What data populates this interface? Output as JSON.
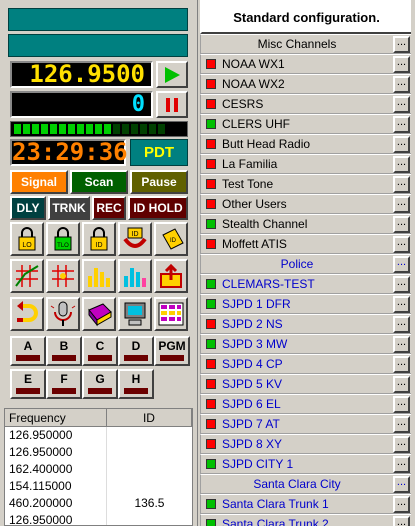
{
  "display": {
    "frequency": "126.9500",
    "counter": "0",
    "clock": "23:29:36",
    "timezone": "PDT"
  },
  "vu_level": {
    "lit": 11,
    "total": 17
  },
  "mode_buttons": [
    {
      "label": "Signal",
      "color": "#ff8000",
      "text": "#ffffff"
    },
    {
      "label": "Scan",
      "color": "#006000",
      "text": "#ffffff"
    },
    {
      "label": "Pause",
      "color": "#606000",
      "text": "#ffffff"
    }
  ],
  "flag_buttons": [
    {
      "label": "DLY"
    },
    {
      "label": "TRNK"
    },
    {
      "label": "REC"
    },
    {
      "label": "ID HOLD"
    }
  ],
  "icons_row1": [
    "lock-lo-icon",
    "lock-tlo-icon",
    "lock-id-icon",
    "hand-id-icon",
    "tag-id-icon"
  ],
  "icons_row2": [
    "grid-red-icon",
    "grid-red2-icon",
    "bars-yellow-icon",
    "bars-cyan-icon",
    "export-icon"
  ],
  "icons_row3": [
    "undo-icon",
    "microphone-icon",
    "book-icon",
    "computer-icon",
    "table-icon"
  ],
  "memory_buttons": [
    "A",
    "B",
    "C",
    "D",
    "PGM",
    "E",
    "F",
    "G",
    "H"
  ],
  "freq_table": {
    "headers": [
      "Frequency",
      "ID"
    ],
    "rows": [
      {
        "freq": "126.950000",
        "id": ""
      },
      {
        "freq": "126.950000",
        "id": ""
      },
      {
        "freq": "162.400000",
        "id": ""
      },
      {
        "freq": "154.115000",
        "id": ""
      },
      {
        "freq": "460.200000",
        "id": "136.5"
      },
      {
        "freq": "126.950000",
        "id": ""
      }
    ]
  },
  "config": {
    "title": "Standard configuration.",
    "dots": "...",
    "groups": [
      {
        "label": "Misc Channels",
        "style": "black",
        "channels": [
          {
            "name": "NOAA WX1",
            "led": "red"
          },
          {
            "name": "NOAA WX2",
            "led": "red"
          },
          {
            "name": "CESRS",
            "led": "red"
          },
          {
            "name": "CLERS UHF",
            "led": "green"
          },
          {
            "name": "Butt Head Radio",
            "led": "red"
          },
          {
            "name": "La Familia",
            "led": "red"
          },
          {
            "name": "Test Tone",
            "led": "red"
          },
          {
            "name": "Other Users",
            "led": "red"
          },
          {
            "name": "Stealth Channel",
            "led": "green"
          },
          {
            "name": "Moffett ATIS",
            "led": "red"
          }
        ]
      },
      {
        "label": "Police",
        "style": "blue",
        "channels": [
          {
            "name": "CLEMARS-TEST",
            "led": "green"
          },
          {
            "name": "SJPD 1 DFR",
            "led": "green"
          },
          {
            "name": "SJPD 2 NS",
            "led": "red"
          },
          {
            "name": "SJPD 3 MW",
            "led": "green"
          },
          {
            "name": "SJPD 4 CP",
            "led": "red"
          },
          {
            "name": "SJPD 5 KV",
            "led": "red"
          },
          {
            "name": "SJPD 6 EL",
            "led": "red"
          },
          {
            "name": "SJPD 7 AT",
            "led": "red"
          },
          {
            "name": "SJPD 8 XY",
            "led": "red"
          },
          {
            "name": "SJPD CITY 1",
            "led": "green"
          }
        ]
      },
      {
        "label": "Santa Clara City",
        "style": "blue",
        "channels": [
          {
            "name": "Santa Clara Trunk 1",
            "led": "green"
          },
          {
            "name": "Santa Clara Trunk 2",
            "led": "green"
          }
        ]
      }
    ]
  },
  "colors": {
    "led_red": "#ff0000",
    "led_green": "#00c000",
    "lcd_yellow": "#ffe000",
    "lcd_orange": "#ff8000",
    "lcd_cyan": "#00e0ff",
    "teal": "#008080"
  }
}
